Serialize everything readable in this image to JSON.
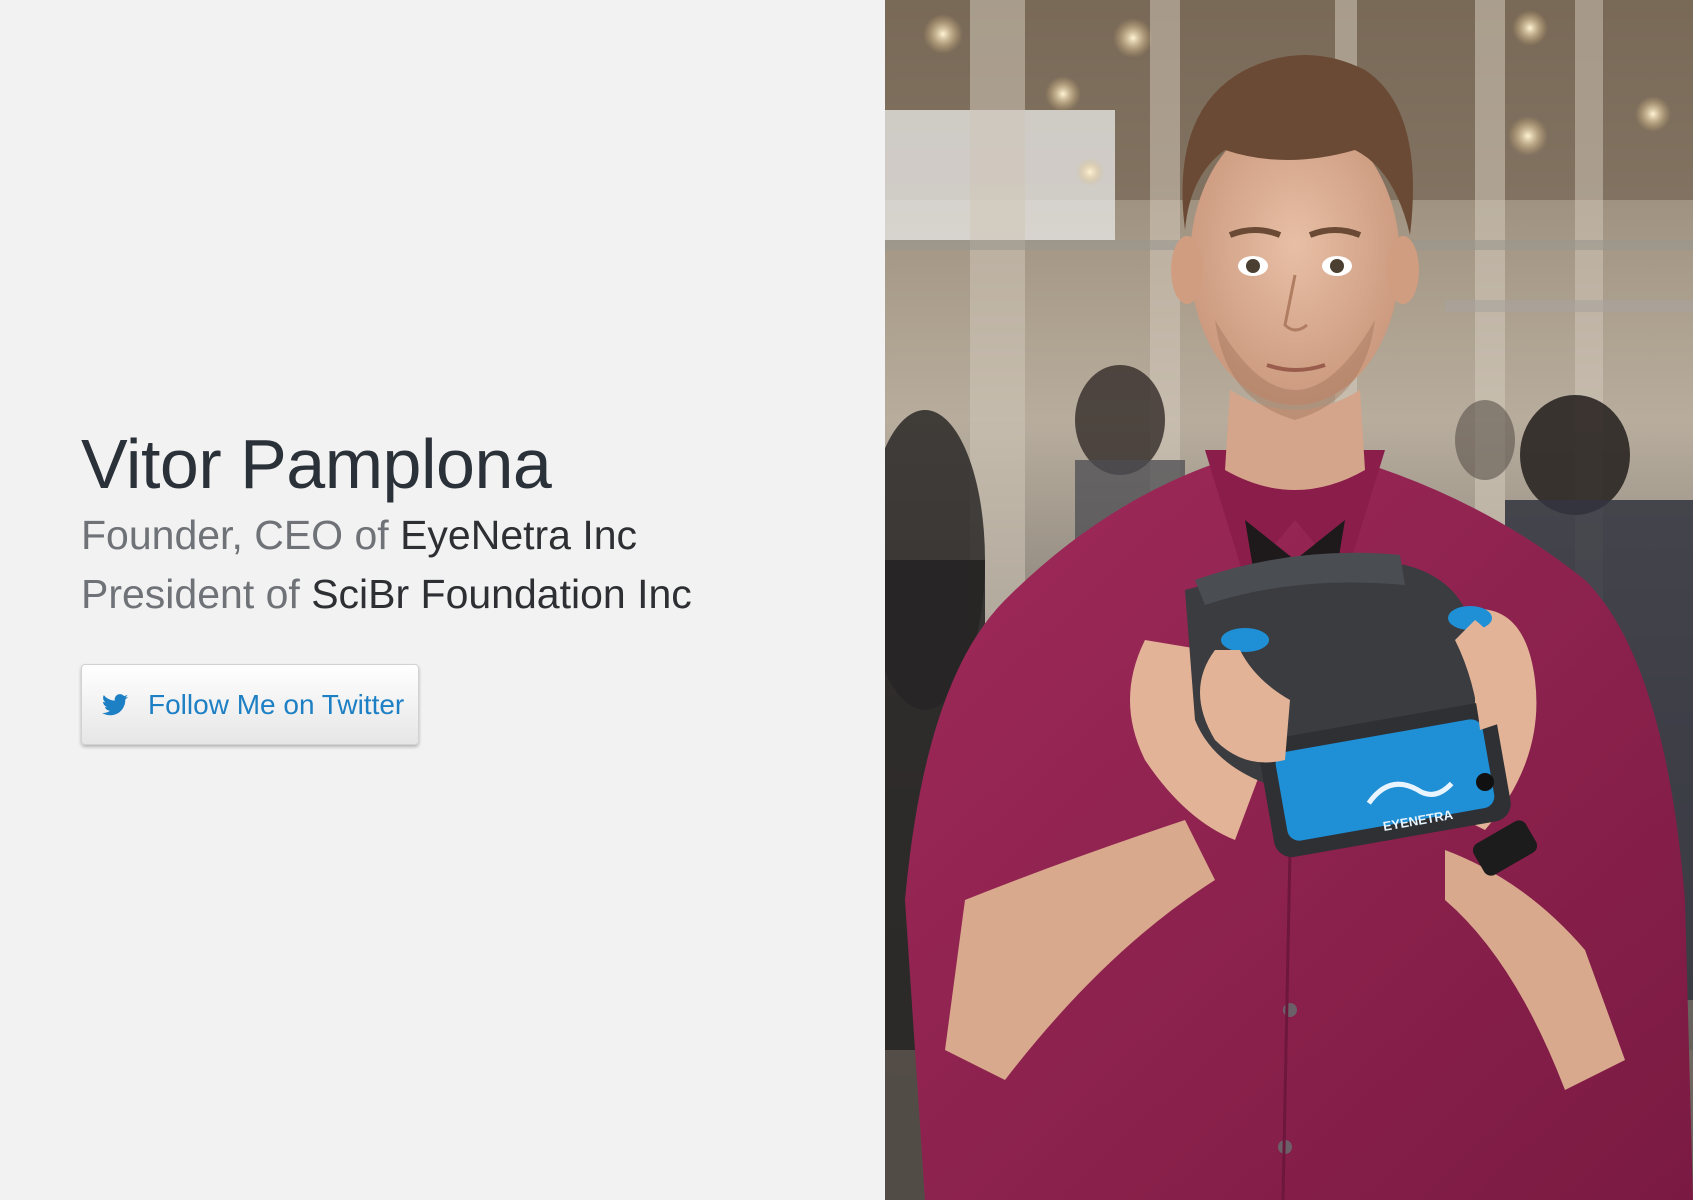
{
  "profile": {
    "name": "Vitor Pamplona",
    "roles": [
      {
        "prefix": "Founder, CEO of ",
        "org": "EyeNetra Inc"
      },
      {
        "prefix": "President of ",
        "org": "SciBr Foundation Inc"
      }
    ]
  },
  "twitter_button": {
    "label": "Follow Me on Twitter",
    "icon": "twitter-bird-icon"
  },
  "photo": {
    "device_brand": "EYENETRA"
  },
  "colors": {
    "background": "#f2f2f2",
    "name_text": "#2b3139",
    "prefix_text": "#6f7277",
    "org_text": "#2d2f33",
    "twitter_blue": "#1d7fc4",
    "shirt": "#8e1f4d",
    "device_blue": "#1f8fd6"
  }
}
